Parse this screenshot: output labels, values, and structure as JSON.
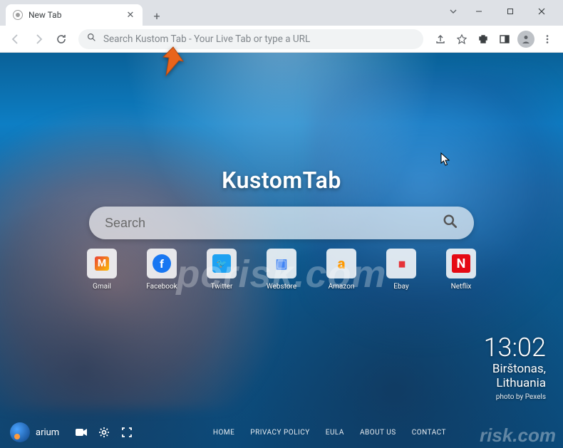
{
  "window": {
    "tab_title": "New Tab"
  },
  "omnibox": {
    "placeholder": "Search Kustom Tab - Your Live Tab or type a URL"
  },
  "page": {
    "brand": "KustomTab",
    "search_placeholder": "Search",
    "shortcuts": [
      {
        "label": "Gmail",
        "glyph": "M"
      },
      {
        "label": "Facebook",
        "glyph": "f"
      },
      {
        "label": "Twitter",
        "glyph": "🐦"
      },
      {
        "label": "Webstore",
        "glyph": "▣"
      },
      {
        "label": "Amazon",
        "glyph": "a"
      },
      {
        "label": "Ebay",
        "glyph": "▮▮"
      },
      {
        "label": "Netflix",
        "glyph": "N"
      }
    ],
    "clock": {
      "time": "13:02",
      "location_line1": "Birštonas,",
      "location_line2": "Lithuania",
      "credit": "photo by Pexels"
    },
    "theme": {
      "name": "arium"
    },
    "footer_links": [
      "HOME",
      "PRIVACY POLICY",
      "EULA",
      "ABOUT US",
      "CONTACT"
    ]
  },
  "watermark": "pcrisk.com",
  "watermark2": "risk.com"
}
